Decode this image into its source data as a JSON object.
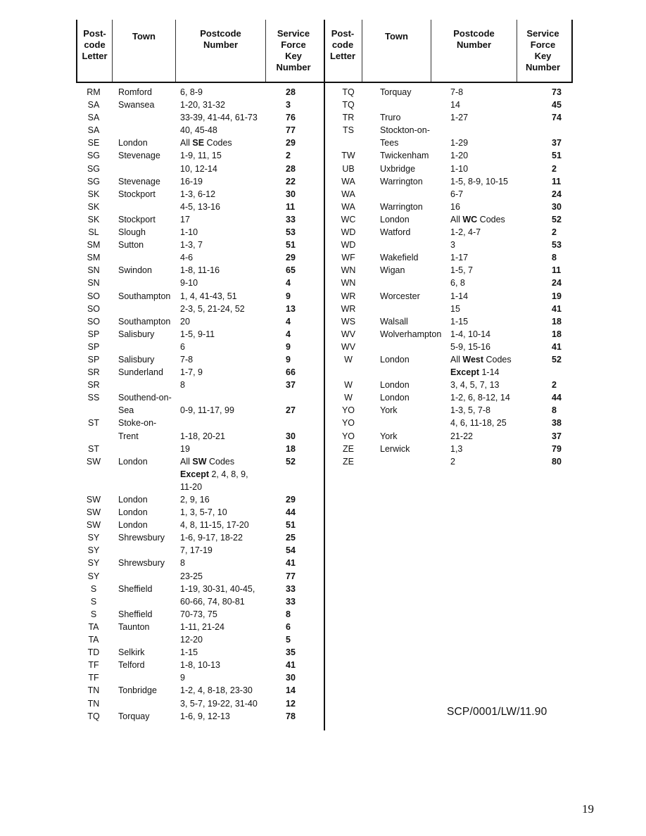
{
  "headers": {
    "postcode_letter": "Post-\ncode\nLetter",
    "town": "Town",
    "postcode_number": "Postcode\nNumber",
    "service_force_key_number": "Service\nForce\nKey\nNumber"
  },
  "left_table": [
    {
      "letter": "RM",
      "town": "Romford",
      "number": "6, 8-9",
      "key": "28"
    },
    {
      "letter": "SA",
      "town": "Swansea",
      "number": "1-20, 31-32",
      "key": "3"
    },
    {
      "letter": "SA",
      "town": "",
      "number": "33-39, 41-44, 61-73",
      "key": "76"
    },
    {
      "letter": "SA",
      "town": "",
      "number": "40, 45-48",
      "key": "77"
    },
    {
      "letter": "SE",
      "town": "London",
      "number_prefix": "All ",
      "number_bold": "SE",
      "number": " Codes",
      "key": "29"
    },
    {
      "letter": "SG",
      "town": "Stevenage",
      "number": "1-9, 11, 15",
      "key": "2"
    },
    {
      "letter": "SG",
      "town": "",
      "number": "10, 12-14",
      "key": "28"
    },
    {
      "letter": "SG",
      "town": "Stevenage",
      "number": "16-19",
      "key": "22"
    },
    {
      "letter": "SK",
      "town": "Stockport",
      "number": "1-3, 6-12",
      "key": "30"
    },
    {
      "letter": "SK",
      "town": "",
      "number": "4-5, 13-16",
      "key": "11"
    },
    {
      "letter": "SK",
      "town": "Stockport",
      "number": "17",
      "key": "33"
    },
    {
      "letter": "SL",
      "town": "Slough",
      "number": "1-10",
      "key": "53"
    },
    {
      "letter": "SM",
      "town": "Sutton",
      "number": "1-3, 7",
      "key": "51"
    },
    {
      "letter": "SM",
      "town": "",
      "number": "4-6",
      "key": "29"
    },
    {
      "letter": "SN",
      "town": "Swindon",
      "number": "1-8, 11-16",
      "key": "65"
    },
    {
      "letter": "SN",
      "town": "",
      "number": "9-10",
      "key": "4"
    },
    {
      "letter": "SO",
      "town": "Southampton",
      "number": "1, 4, 41-43, 51",
      "key": "9"
    },
    {
      "letter": "SO",
      "town": "",
      "number": "2-3, 5, 21-24, 52",
      "key": "13"
    },
    {
      "letter": "SO",
      "town": "Southampton",
      "number": "20",
      "key": "4"
    },
    {
      "letter": "SP",
      "town": "Salisbury",
      "number": "1-5, 9-11",
      "key": "4"
    },
    {
      "letter": "SP",
      "town": "",
      "number": "6",
      "key": "9"
    },
    {
      "letter": "SP",
      "town": "Salisbury",
      "number": "7-8",
      "key": "9"
    },
    {
      "letter": "SR",
      "town": "Sunderland",
      "number": "1-7, 9",
      "key": "66"
    },
    {
      "letter": "SR",
      "town": "",
      "number": "8",
      "key": "37"
    },
    {
      "letter": "SS",
      "town": "Southend-on-",
      "number": "",
      "key": ""
    },
    {
      "letter": "",
      "town": "Sea",
      "number": "0-9, 11-17, 99",
      "key": "27"
    },
    {
      "letter": "ST",
      "town": "Stoke-on-",
      "number": "",
      "key": ""
    },
    {
      "letter": "",
      "town": "Trent",
      "number": "1-18, 20-21",
      "key": "30"
    },
    {
      "letter": "ST",
      "town": "",
      "number": "19",
      "key": "18"
    },
    {
      "letter": "SW",
      "town": "London",
      "number_prefix": "All ",
      "number_bold": "SW",
      "number": " Codes",
      "key": "52"
    },
    {
      "letter": "",
      "town": "",
      "number_bold": "Except",
      "number": " 2, 4, 8, 9,",
      "key": ""
    },
    {
      "letter": "",
      "town": "",
      "number": "11-20",
      "key": ""
    },
    {
      "letter": "SW",
      "town": "London",
      "number": "2, 9, 16",
      "key": "29"
    },
    {
      "letter": "SW",
      "town": "London",
      "number": "1, 3, 5-7, 10",
      "key": "44"
    },
    {
      "letter": "SW",
      "town": "London",
      "number": "4, 8, 11-15, 17-20",
      "key": "51"
    },
    {
      "letter": "SY",
      "town": "Shrewsbury",
      "number": "1-6, 9-17, 18-22",
      "key": "25"
    },
    {
      "letter": "SY",
      "town": "",
      "number": "7, 17-19",
      "key": "54"
    },
    {
      "letter": "SY",
      "town": "Shrewsbury",
      "number": "8",
      "key": "41"
    },
    {
      "letter": "SY",
      "town": "",
      "number": "23-25",
      "key": "77"
    },
    {
      "letter": "S",
      "town": "Sheffield",
      "number": "1-19, 30-31, 40-45,",
      "key": "33"
    },
    {
      "letter": "S",
      "town": "",
      "number": "60-66, 74, 80-81",
      "key": "33"
    },
    {
      "letter": "S",
      "town": "Sheffield",
      "number": "70-73, 75",
      "key": "8"
    },
    {
      "letter": "TA",
      "town": "Taunton",
      "number": "1-11, 21-24",
      "key": "6"
    },
    {
      "letter": "TA",
      "town": "",
      "number": "12-20",
      "key": "5"
    },
    {
      "letter": "TD",
      "town": "Selkirk",
      "number": "1-15",
      "key": "35"
    },
    {
      "letter": "TF",
      "town": "Telford",
      "number": "1-8, 10-13",
      "key": "41"
    },
    {
      "letter": "TF",
      "town": "",
      "number": "9",
      "key": "30"
    },
    {
      "letter": "TN",
      "town": "Tonbridge",
      "number": "1-2, 4, 8-18, 23-30",
      "key": "14"
    },
    {
      "letter": "TN",
      "town": "",
      "number": "3, 5-7, 19-22, 31-40",
      "key": "12"
    },
    {
      "letter": "TQ",
      "town": "Torquay",
      "number": "1-6, 9, 12-13",
      "key": "78"
    }
  ],
  "right_table": [
    {
      "letter": "TQ",
      "town": "Torquay",
      "number": "7-8",
      "key": "73"
    },
    {
      "letter": "TQ",
      "town": "",
      "number": "14",
      "key": "45"
    },
    {
      "letter": "TR",
      "town": "Truro",
      "number": "1-27",
      "key": "74"
    },
    {
      "letter": "TS",
      "town": "Stockton-on-",
      "number": "",
      "key": ""
    },
    {
      "letter": "",
      "town": "Tees",
      "number": "1-29",
      "key": "37"
    },
    {
      "letter": "TW",
      "town": "Twickenham",
      "number": "1-20",
      "key": "51"
    },
    {
      "letter": "UB",
      "town": "Uxbridge",
      "number": "1-10",
      "key": "2"
    },
    {
      "letter": "WA",
      "town": "Warrington",
      "number": "1-5, 8-9, 10-15",
      "key": "11"
    },
    {
      "letter": "WA",
      "town": "",
      "number": "6-7",
      "key": "24"
    },
    {
      "letter": "WA",
      "town": "Warrington",
      "number": "16",
      "key": "30"
    },
    {
      "letter": "WC",
      "town": "London",
      "number_prefix": "All ",
      "number_bold": "WC",
      "number": " Codes",
      "key": "52"
    },
    {
      "letter": "WD",
      "town": "Watford",
      "number": "1-2, 4-7",
      "key": "2"
    },
    {
      "letter": "WD",
      "town": "",
      "number": "3",
      "key": "53"
    },
    {
      "letter": "WF",
      "town": "Wakefield",
      "number": "1-17",
      "key": "8"
    },
    {
      "letter": "WN",
      "town": "Wigan",
      "number": "1-5, 7",
      "key": "11"
    },
    {
      "letter": "WN",
      "town": "",
      "number": "6, 8",
      "key": "24"
    },
    {
      "letter": "WR",
      "town": "Worcester",
      "number": "1-14",
      "key": "19"
    },
    {
      "letter": "WR",
      "town": "",
      "number": "15",
      "key": "41"
    },
    {
      "letter": "WS",
      "town": "Walsall",
      "number": "1-15",
      "key": "18"
    },
    {
      "letter": "WV",
      "town": "Wolverhampton",
      "number": "1-4, 10-14",
      "key": "18"
    },
    {
      "letter": "WV",
      "town": "",
      "number": "5-9, 15-16",
      "key": "41"
    },
    {
      "letter": "W",
      "town": "London",
      "number_prefix": "All ",
      "number_bold": "West",
      "number": " Codes",
      "key": "52"
    },
    {
      "letter": "",
      "town": "",
      "number_bold": "Except",
      "number": " 1-14",
      "key": ""
    },
    {
      "letter": "W",
      "town": "London",
      "number": "3, 4, 5, 7, 13",
      "key": "2"
    },
    {
      "letter": "W",
      "town": "London",
      "number": "1-2, 6, 8-12, 14",
      "key": "44"
    },
    {
      "letter": "YO",
      "town": "York",
      "number": "1-3, 5, 7-8",
      "key": "8"
    },
    {
      "letter": "YO",
      "town": "",
      "number": "4, 6, 11-18, 25",
      "key": "38"
    },
    {
      "letter": "YO",
      "town": "York",
      "number": "21-22",
      "key": "37"
    },
    {
      "letter": "ZE",
      "town": "Lerwick",
      "number": "1,3",
      "key": "79"
    },
    {
      "letter": "ZE",
      "town": "",
      "number": "2",
      "key": "80"
    }
  ],
  "footer": {
    "reference_code": "SCP/0001/LW/11.90",
    "page_number": "19"
  }
}
